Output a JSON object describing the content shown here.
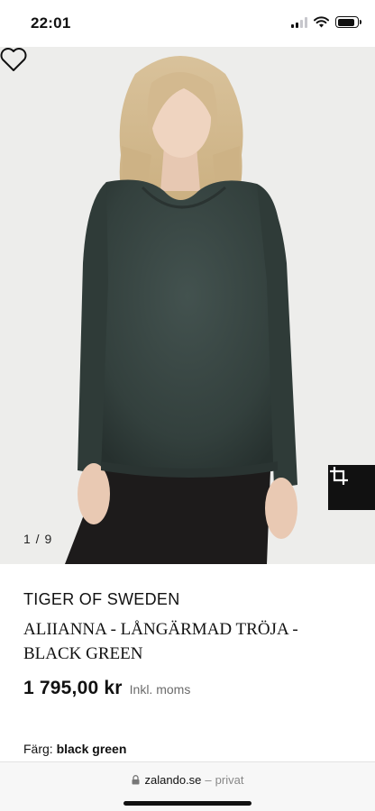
{
  "status_bar": {
    "time": "22:01",
    "icons": [
      "cellular-signal-icon",
      "wifi-icon",
      "battery-icon"
    ],
    "battery_level": 0.9
  },
  "gallery": {
    "counter": "1 / 9",
    "wishlist_icon": "heart-outline-icon",
    "share_icon": "share-frame-icon",
    "background_color": "#ededeb",
    "garment_color": "#33403d"
  },
  "product": {
    "brand": "TIGER OF SWEDEN",
    "name": "ALIIANNA - LÅNGÄRMAD TRÖJA - BLACK GREEN",
    "price": "1 795,00 kr",
    "vat_note": "Inkl. moms",
    "color_label": "Färg:",
    "color_value": "black green"
  },
  "browser": {
    "domain": "zalando.se",
    "separator": "–",
    "mode": "privat",
    "lock_icon": "lock-icon"
  }
}
